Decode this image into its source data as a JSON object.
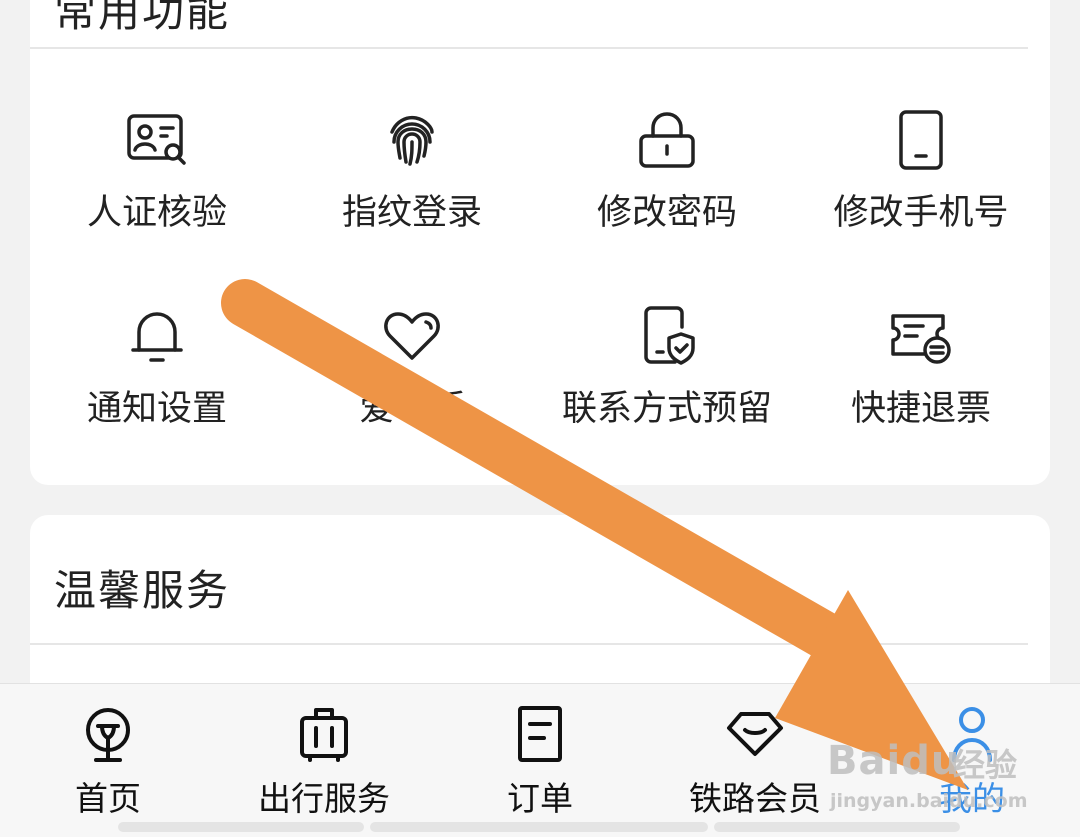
{
  "sections": {
    "common": {
      "title": "常用功能",
      "items": [
        {
          "label": "人证核验",
          "icon": "id-card-search-icon"
        },
        {
          "label": "指纹登录",
          "icon": "fingerprint-icon"
        },
        {
          "label": "修改密码",
          "icon": "lock-icon"
        },
        {
          "label": "修改手机号",
          "icon": "phone-icon"
        },
        {
          "label": "通知设置",
          "icon": "bell-icon"
        },
        {
          "label": "爱心版",
          "icon": "heart-icon"
        },
        {
          "label": "联系方式预留",
          "icon": "phone-shield-icon"
        },
        {
          "label": "快捷退票",
          "icon": "ticket-refund-icon"
        }
      ]
    },
    "warm": {
      "title": "温馨服务"
    }
  },
  "bottom_nav": {
    "items": [
      {
        "label": "首页",
        "icon": "railway-logo-icon"
      },
      {
        "label": "出行服务",
        "icon": "luggage-icon"
      },
      {
        "label": "订单",
        "icon": "order-list-icon"
      },
      {
        "label": "铁路会员",
        "icon": "diamond-icon"
      },
      {
        "label": "我的",
        "icon": "person-icon"
      }
    ],
    "active": "我的"
  },
  "colors": {
    "accent": "#3b8fe6",
    "arrow": "#ee9446",
    "text": "#222222",
    "background": "#f2f2f2",
    "card": "#ffffff"
  },
  "watermark": {
    "brand": "Baidu",
    "cn": "经验",
    "url": "jingyan.baidu.com"
  }
}
